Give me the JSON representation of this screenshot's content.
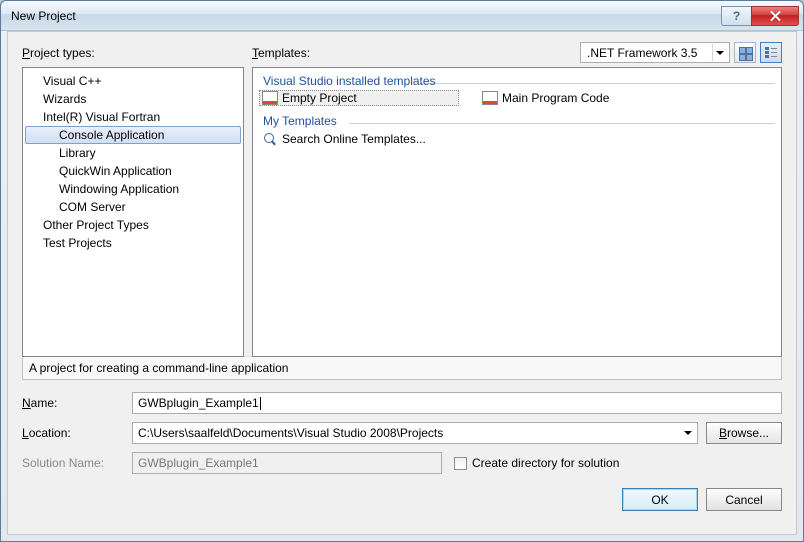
{
  "title": "New Project",
  "labels": {
    "project_types": "Project types:",
    "templates": "Templates:",
    "name": "Name:",
    "location": "Location:",
    "solution_name": "Solution Name:",
    "browse": "Browse...",
    "ok": "OK",
    "cancel": "Cancel",
    "create_dir": "Create directory for solution"
  },
  "framework": {
    "selected": ".NET Framework 3.5"
  },
  "tree": {
    "items": [
      {
        "label": "Visual C++",
        "level": 1
      },
      {
        "label": "Wizards",
        "level": 1
      },
      {
        "label": "Intel(R) Visual Fortran",
        "level": 1
      },
      {
        "label": "Console Application",
        "level": 2,
        "selected": true
      },
      {
        "label": "Library",
        "level": 2
      },
      {
        "label": "QuickWin Application",
        "level": 2
      },
      {
        "label": "Windowing Application",
        "level": 2
      },
      {
        "label": "COM Server",
        "level": 2
      },
      {
        "label": "Other Project Types",
        "level": 1
      },
      {
        "label": "Test Projects",
        "level": 1
      }
    ]
  },
  "templates": {
    "group1": "Visual Studio installed templates",
    "group2": "My Templates",
    "items1": [
      {
        "label": "Empty Project",
        "selected": true
      },
      {
        "label": "Main Program Code"
      }
    ],
    "items2": [
      {
        "label": "Search Online Templates..."
      }
    ]
  },
  "description": "A project for creating a command-line application",
  "fields": {
    "name": "GWBplugin_Example1",
    "location": "C:\\Users\\saalfeld\\Documents\\Visual Studio 2008\\Projects",
    "solution_name": "GWBplugin_Example1"
  }
}
